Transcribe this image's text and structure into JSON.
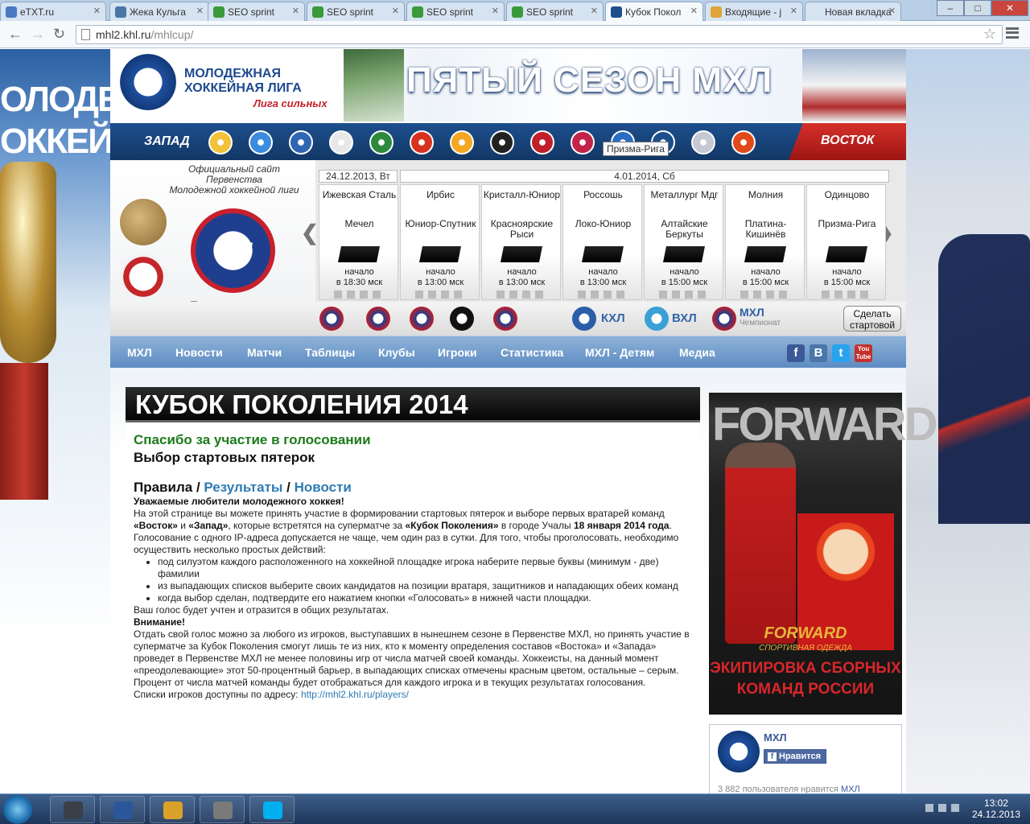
{
  "browser": {
    "tabs": [
      {
        "label": "eTXT.ru",
        "color": "#4a78c2"
      },
      {
        "label": "Жека Кульга",
        "color": "#4a76a8"
      },
      {
        "label": "SEO sprint",
        "color": "#3a9a3a"
      },
      {
        "label": "SEO sprint",
        "color": "#3a9a3a"
      },
      {
        "label": "SEO sprint",
        "color": "#3a9a3a"
      },
      {
        "label": "SEO sprint",
        "color": "#3a9a3a"
      },
      {
        "label": "Кубок Покол",
        "color": "#1d4f8d"
      },
      {
        "label": "Входящие - j",
        "color": "#e0a43a"
      },
      {
        "label": "Новая вкладка",
        "color": ""
      }
    ],
    "url_host": "mhl2.khl.ru",
    "url_path": "/mhlcup/"
  },
  "banner": {
    "season_badge": "5",
    "org_line1": "МОЛОДЕЖНАЯ",
    "org_line2": "ХОККЕЙНАЯ ЛИГА",
    "org_slogan": "Лига сильных",
    "season_title": "ПЯТЫЙ СЕЗОН МХЛ"
  },
  "teambar": {
    "west": "ЗАПАД",
    "east": "ВОСТОК",
    "tooltip": "Призма-Рига",
    "team_count": 14
  },
  "info": {
    "official": [
      "Официальный сайт",
      "Первенства",
      "Молодежной хоккейной лиги"
    ],
    "logo_text": "МХЛ",
    "logo_slogan": "Лига сильных"
  },
  "games": {
    "date1": "24.12.2013, Вт",
    "date2": "4.01.2014, Сб",
    "list": [
      {
        "home": "Ижевская Сталь",
        "away": "Мечел",
        "status": "начало",
        "time": "в 18:30 мск"
      },
      {
        "home": "Ирбис",
        "away": "Юниор-Спутник",
        "status": "начало",
        "time": "в 13:00 мск"
      },
      {
        "home": "Кристалл-Юниор",
        "away": "Красноярские Рыси",
        "status": "начало",
        "time": "в 13:00 мск"
      },
      {
        "home": "Россошь",
        "away": "Локо-Юниор",
        "status": "начало",
        "time": "в 13:00 мск"
      },
      {
        "home": "Металлург Мдг",
        "away": "Алтайские Беркуты",
        "status": "начало",
        "time": "в 15:00 мск"
      },
      {
        "home": "Молния",
        "away": "Платина-Кишинёв",
        "status": "начало",
        "time": "в 15:00 мск"
      },
      {
        "home": "Одинцово",
        "away": "Призма-Рига",
        "status": "начало",
        "time": "в 15:00 мск"
      }
    ]
  },
  "leagues": {
    "khl": "КХЛ",
    "vhl": "ВХЛ",
    "mhl": "МХЛ",
    "mhl_sub": "Чемпионат",
    "start_button": "Сделать стартовой"
  },
  "nav": [
    "МХЛ",
    "Новости",
    "Матчи",
    "Таблицы",
    "Клубы",
    "Игроки",
    "Статистика",
    "МХЛ - Детям",
    "Медиа"
  ],
  "social": {
    "fb": "f",
    "vk": "B",
    "tw": "t",
    "yt": "You Tube"
  },
  "article": {
    "title": "КУБОК ПОКОЛЕНИЯ 2014",
    "thanks": "Спасибо за участие в голосовании",
    "choice": "Выбор стартовых пятерок",
    "rules": "Правила",
    "sep": " / ",
    "results": "Результаты",
    "news": "Новости",
    "greeting": "Уважаемые любители молодежного хоккея!",
    "p1_a": "На этой странице вы можете принять участие в формировании стартовых пятерок и выборе первых вратарей команд ",
    "p1_east": "«Восток»",
    "p1_and": " и ",
    "p1_west": "«Запад»",
    "p1_b": ", которые встретятся на суперматче за ",
    "p1_cup": "«Кубок Поколения»",
    "p1_c": " в городе Учалы ",
    "p1_date": "18 января 2014 года",
    "p1_d": ".",
    "p2": "Голосование с одного IP-адреса допускается не чаще, чем один раз в сутки. Для того, чтобы проголосовать, необходимо осуществить несколько простых действий:",
    "li1": "под силуэтом каждого расположенного на хоккейной площадке игрока наберите первые буквы (минимум - две) фамилии",
    "li2": "из выпадающих списков выберите своих кандидатов на позиции вратаря, защитников и нападающих обеих команд",
    "li3": "когда выбор сделан, подтвердите его нажатием кнопки «Голосовать» в нижней части площадки.",
    "p3": "Ваш голос будет учтен и отразится в общих результатах.",
    "attention": "Внимание!",
    "p4": "Отдать свой голос можно за любого из игроков, выступавших в нынешнем сезоне в Первенстве МХЛ, но принять участие в суперматче за Кубок Поколения смогут лишь те из них, кто к моменту определения составов «Востока» и «Запада» проведет в Первенстве МХЛ не менее половины игр от числа матчей своей команды. Хоккеисты, на данный момент «преодолевающие» этот 50-процентный барьер, в выпадающих списках отмечены красным цветом, остальные – серым. Процент от числа матчей команды будет отображаться для каждого игрока и в текущих результатах голосования.",
    "p5": "Списки игроков доступны по адресу: ",
    "link": "http://mhl2.khl.ru/players/"
  },
  "ad": {
    "brand_big": "FORWARD",
    "brand": "FORWARD",
    "brand_sub": "СПОРТИВНАЯ ОДЕЖДА",
    "slogan1": "ЭКИПИРОВКА СБОРНЫХ",
    "slogan2": "КОМАНД РОССИИ"
  },
  "fb": {
    "name": "МХЛ",
    "like": "Нравится",
    "count_pre": "3 882 пользователя нравится ",
    "count_link": "МХЛ"
  },
  "taskbar": {
    "apps": [
      {
        "name": "steam",
        "color": "#3a3f48"
      },
      {
        "name": "word",
        "color": "#2b579a"
      },
      {
        "name": "chrome",
        "color": "#d9a12a"
      },
      {
        "name": "media",
        "color": "#7a7a7a"
      },
      {
        "name": "skype",
        "color": "#00aff0"
      }
    ],
    "time": "13:02",
    "date": "24.12.2013"
  }
}
